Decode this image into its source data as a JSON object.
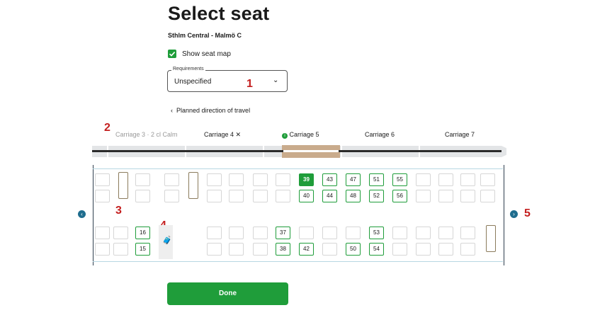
{
  "header": {
    "title": "Select seat",
    "route": "Sthlm Central - Malmö C"
  },
  "seatmap_toggle": {
    "label": "Show seat map",
    "checked": true
  },
  "requirements": {
    "legend": "Requirements",
    "value": "Unspecified"
  },
  "direction": {
    "label": "Planned direction of travel"
  },
  "carriages": [
    {
      "label": "Carriage 3",
      "suffix": "· 2 cl Calm",
      "selected": false
    },
    {
      "label": "Carriage 4",
      "selected": false
    },
    {
      "label": "Carriage 5",
      "selected": true
    },
    {
      "label": "Carriage 6",
      "selected": false
    },
    {
      "label": "Carriage 7",
      "selected": false
    }
  ],
  "seats": {
    "selected": "39",
    "available": [
      "39",
      "40",
      "43",
      "44",
      "47",
      "48",
      "51",
      "52",
      "55",
      "56",
      "16",
      "15",
      "37",
      "38",
      "42",
      "50",
      "53",
      "54"
    ]
  },
  "annotations": [
    "1",
    "2",
    "3",
    "4",
    "5"
  ],
  "footer": {
    "done_label": "Done"
  },
  "colors": {
    "accent": "#1f9d3a",
    "annotation": "#c41f1f",
    "nav": "#1f6d8e"
  }
}
